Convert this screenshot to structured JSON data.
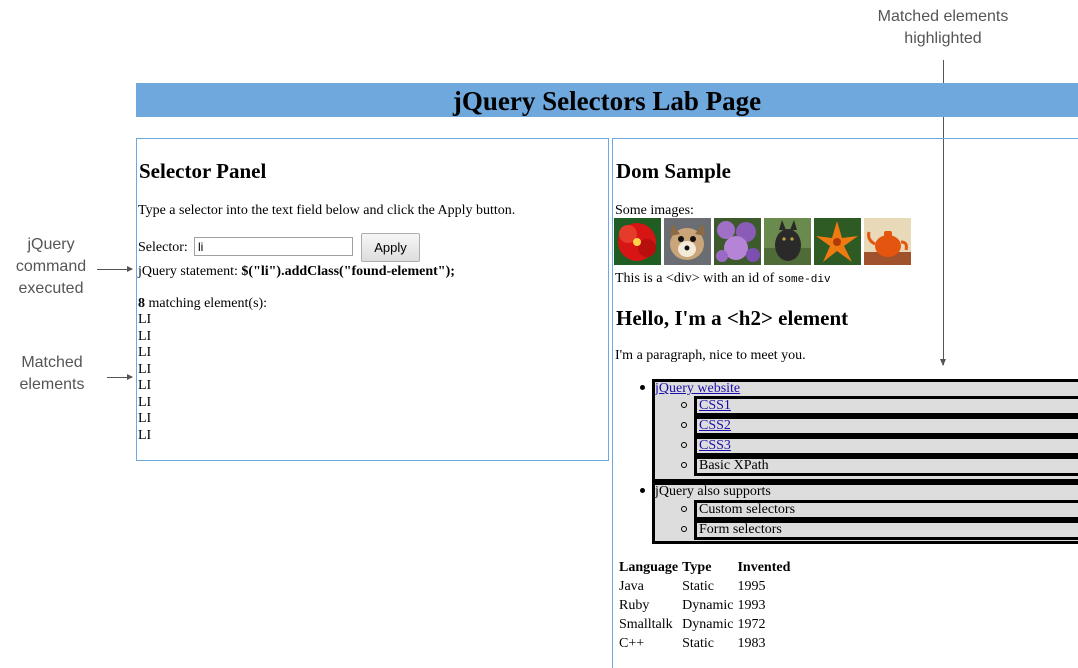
{
  "callouts": {
    "matched_highlighted": "Matched elements highlighted",
    "command_executed": "jQuery command executed",
    "matched_elements": "Matched elements"
  },
  "page_title": "jQuery Selectors Lab Page",
  "selector_panel": {
    "heading": "Selector Panel",
    "instructions": "Type a selector into the text field below and click the Apply button.",
    "selector_label": "Selector:",
    "selector_value": "li",
    "apply_label": "Apply",
    "statement_prefix": "jQuery statement:",
    "statement_code": "$(\"li\").addClass(\"found-element\");",
    "match_count": "8",
    "match_suffix": "matching element(s):",
    "matches": [
      "LI",
      "LI",
      "LI",
      "LI",
      "LI",
      "LI",
      "LI",
      "LI"
    ]
  },
  "dom_sample": {
    "heading": "Dom Sample",
    "images_label": "Some images:",
    "images": [
      "hibiscus-flower",
      "dog",
      "purple-flowers",
      "dog-dark",
      "orange-lily",
      "teapot"
    ],
    "div_text_prefix": "This is a <div> with an id of",
    "div_id": "some-div",
    "h2_text": "Hello, I'm a <h2> element",
    "paragraph": "I'm a paragraph, nice to meet you.",
    "list": [
      {
        "label": "jQuery website",
        "link": true,
        "children": [
          {
            "label": "CSS1",
            "link": true
          },
          {
            "label": "CSS2",
            "link": true
          },
          {
            "label": "CSS3",
            "link": true
          },
          {
            "label": "Basic XPath",
            "link": false
          }
        ]
      },
      {
        "label": "jQuery also supports",
        "link": false,
        "children": [
          {
            "label": "Custom selectors",
            "link": false
          },
          {
            "label": "Form selectors",
            "link": false
          }
        ]
      }
    ],
    "table": {
      "headers": [
        "Language",
        "Type",
        "Invented"
      ],
      "rows": [
        [
          "Java",
          "Static",
          "1995"
        ],
        [
          "Ruby",
          "Dynamic",
          "1993"
        ],
        [
          "Smalltalk",
          "Dynamic",
          "1972"
        ],
        [
          "C++",
          "Static",
          "1983"
        ]
      ]
    }
  }
}
